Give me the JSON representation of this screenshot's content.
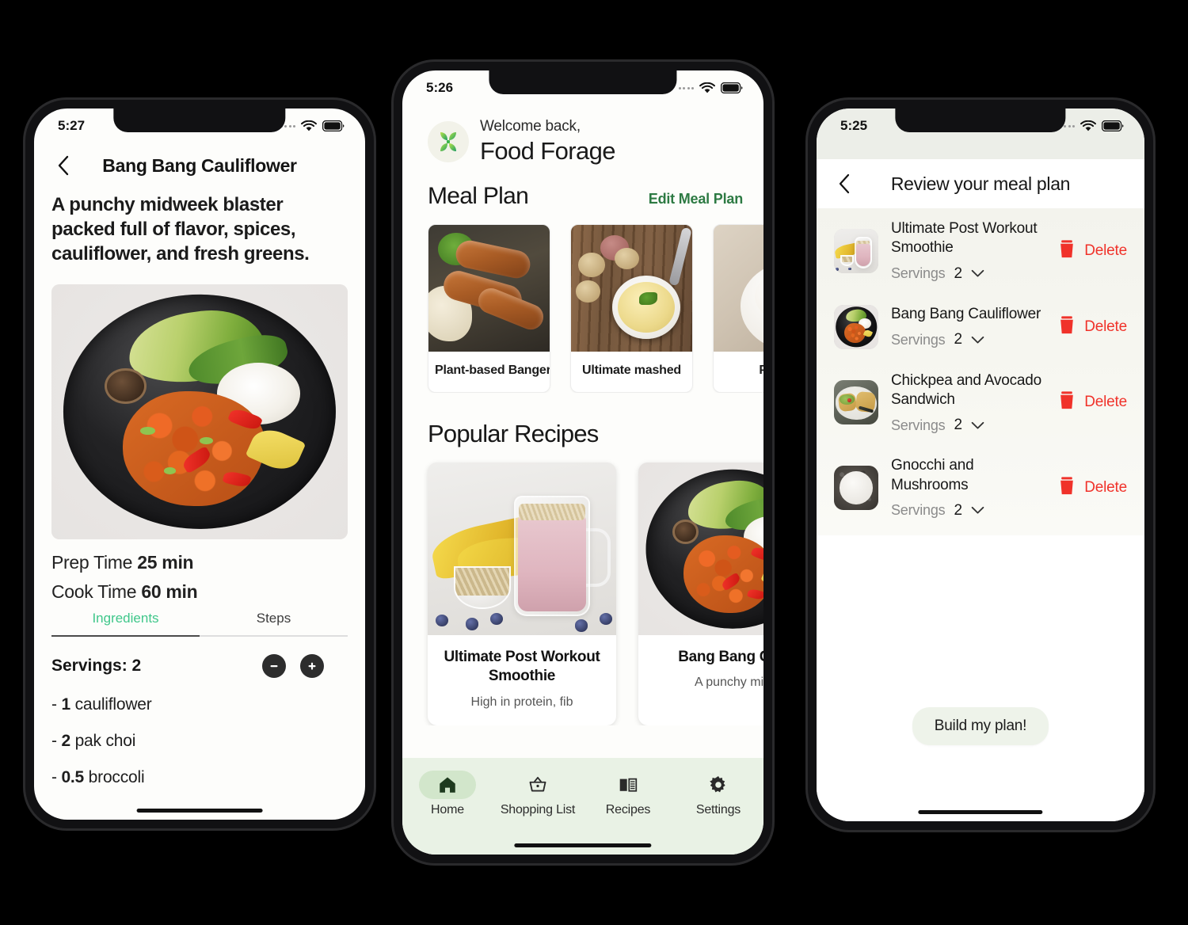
{
  "phone1": {
    "status": {
      "time": "5:27"
    },
    "nav": {
      "back_icon": "chevron-left-icon",
      "title": "Bang Bang Cauliflower"
    },
    "description": "A punchy midweek blaster packed full of flavor, spices, cauliflower, and fresh greens.",
    "hero_image_alt": "bang-bang-cauliflower-plate",
    "prep": {
      "label": "Prep Time",
      "value": "25 min"
    },
    "cook": {
      "label": "Cook Time",
      "value": "60 min"
    },
    "tabs": [
      {
        "label": "Ingredients",
        "active": true
      },
      {
        "label": "Steps",
        "active": false
      }
    ],
    "servings": {
      "label": "Servings: 2",
      "decrement_icon": "minus-icon",
      "increment_icon": "plus-icon"
    },
    "ingredients": [
      {
        "dash": "-",
        "qty": "1",
        "name": "cauliflower"
      },
      {
        "dash": "-",
        "qty": "2",
        "name": "pak choi"
      },
      {
        "dash": "-",
        "qty": "0.5",
        "name": "broccoli"
      }
    ]
  },
  "phone2": {
    "status": {
      "time": "5:26"
    },
    "welcome": {
      "greeting": "Welcome back,",
      "app_name": "Food Forage",
      "logo_icon": "leaf-clover-logo-icon"
    },
    "meal_plan": {
      "heading": "Meal Plan",
      "edit_label": "Edit Meal Plan",
      "cards": [
        {
          "title": "Plant-based Bangers and",
          "image": "sausages-and-mash"
        },
        {
          "title": "Ultimate mashed",
          "image": "mashed-potatoes-bowl"
        },
        {
          "title": "Pl Pa",
          "image": "pavlova-plate"
        }
      ]
    },
    "popular": {
      "heading": "Popular Recipes",
      "cards": [
        {
          "title": "Ultimate Post Workout Smoothie",
          "subtitle": "High in protein, fib",
          "image": "pink-smoothie-jar"
        },
        {
          "title": "Bang Bang Cau",
          "subtitle": "A punchy mid",
          "image": "bang-bang-cauliflower-plate"
        }
      ]
    },
    "tabbar": [
      {
        "label": "Home",
        "icon": "home-icon",
        "active": true
      },
      {
        "label": "Shopping List",
        "icon": "basket-icon",
        "active": false
      },
      {
        "label": "Recipes",
        "icon": "book-icon",
        "active": false
      },
      {
        "label": "Settings",
        "icon": "gear-icon",
        "active": false
      }
    ]
  },
  "phone3": {
    "status": {
      "time": "5:25"
    },
    "nav": {
      "back_icon": "chevron-left-icon",
      "title": "Review your meal plan"
    },
    "servings_label": "Servings",
    "delete_label": "Delete",
    "delete_icon": "trash-icon",
    "chevron_icon": "chevron-down-icon",
    "rows": [
      {
        "name": "Ultimate Post Workout Smoothie",
        "servings": "2",
        "image": "pink-smoothie-jar"
      },
      {
        "name": "Bang Bang Cauliflower",
        "servings": "2",
        "image": "bang-bang-cauliflower-plate"
      },
      {
        "name": "Chickpea and Avocado Sandwich",
        "servings": "2",
        "image": "chickpea-avocado-sandwich"
      },
      {
        "name": "Gnocchi and Mushrooms",
        "servings": "2",
        "image": "gnocchi-mushrooms-bowl"
      }
    ],
    "build_button": "Build my plan!"
  },
  "colors": {
    "page_background": "#000000",
    "accent_mint": "#3fc78a",
    "accent_forest": "#2d7a43",
    "delete_red": "#f0322a",
    "tabbar_background": "#e9f2e5",
    "tab_pill": "#d2e6cb",
    "screen_background": "#fdfdfb"
  }
}
